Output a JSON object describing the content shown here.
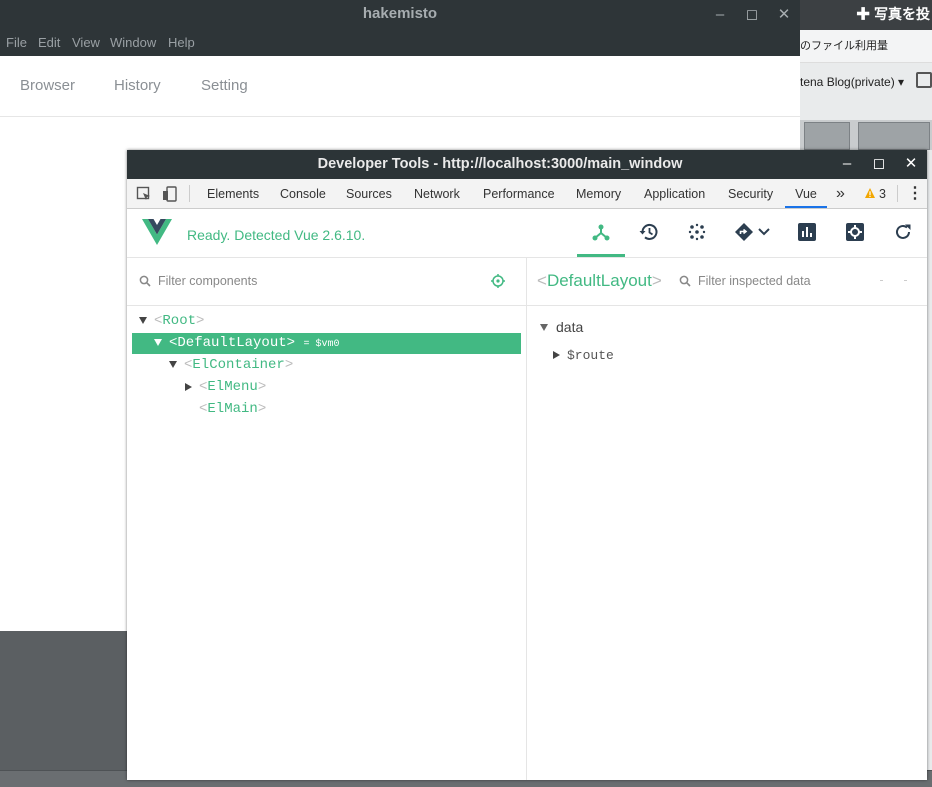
{
  "background_page": {
    "header_text": "✚ 写真を投",
    "storage_text": "のファイル利用量",
    "blog_select": "tena Blog(private) ▾"
  },
  "app": {
    "title": "hakemisto",
    "menu": [
      "File",
      "Edit",
      "View",
      "Window",
      "Help"
    ],
    "nav": [
      "Browser",
      "History",
      "Setting"
    ],
    "window_buttons": {
      "minimize": "–",
      "maximize": "◻",
      "close": "✕"
    }
  },
  "devtools": {
    "title": "Developer Tools - http://localhost:3000/main_window",
    "tabs": [
      "Elements",
      "Console",
      "Sources",
      "Network",
      "Performance",
      "Memory",
      "Application",
      "Security",
      "Vue"
    ],
    "active_tab": "Vue",
    "more_tabs": "»",
    "warnings_count": "3",
    "kebab": "⋮",
    "vue": {
      "status": "Ready. Detected Vue 2.6.10.",
      "filter_components_placeholder": "Filter components",
      "filter_data_placeholder": "Filter inspected data",
      "inspected_component": "DefaultLayout",
      "tree": [
        {
          "name": "Root",
          "depth": 0,
          "expanded": true,
          "selected": false
        },
        {
          "name": "DefaultLayout",
          "depth": 1,
          "expanded": true,
          "selected": true,
          "vm": "= $vm0"
        },
        {
          "name": "ElContainer",
          "depth": 2,
          "expanded": true,
          "selected": false
        },
        {
          "name": "ElMenu",
          "depth": 3,
          "expanded": false,
          "selected": false
        },
        {
          "name": "ElMain",
          "depth": 3,
          "leaf": true,
          "selected": false
        }
      ],
      "data_section": "data",
      "data_items": [
        "$route"
      ]
    }
  },
  "colors": {
    "vue_green": "#42b983",
    "dark_titlebar": "#2c3437",
    "active_tab_underline": "#1a73e8"
  }
}
